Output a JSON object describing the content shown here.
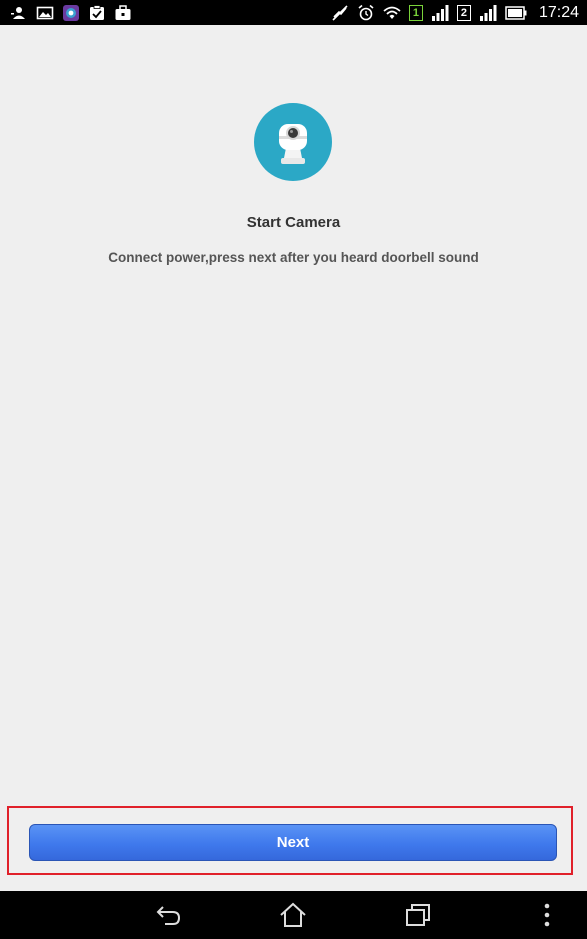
{
  "status_bar": {
    "time": "17:24",
    "sim1_label": "1",
    "sim2_label": "2",
    "left_icons": [
      "person-icon",
      "image-icon",
      "app-icon",
      "clipboard-check-icon",
      "briefcase-icon"
    ],
    "right_icons": [
      "mute-icon",
      "alarm-icon",
      "wifi-icon",
      "signal-icon",
      "signal-icon",
      "battery-icon"
    ]
  },
  "main": {
    "title": "Start Camera",
    "subtitle": "Connect power,press next after you heard doorbell sound",
    "next_label": "Next",
    "accent_color": "#2ba8c6",
    "button_color": "#3f79ec",
    "highlight_color": "#e0202a"
  },
  "nav_bar": {
    "icons": [
      "back-icon",
      "home-icon",
      "recent-apps-icon",
      "more-options-icon"
    ]
  }
}
